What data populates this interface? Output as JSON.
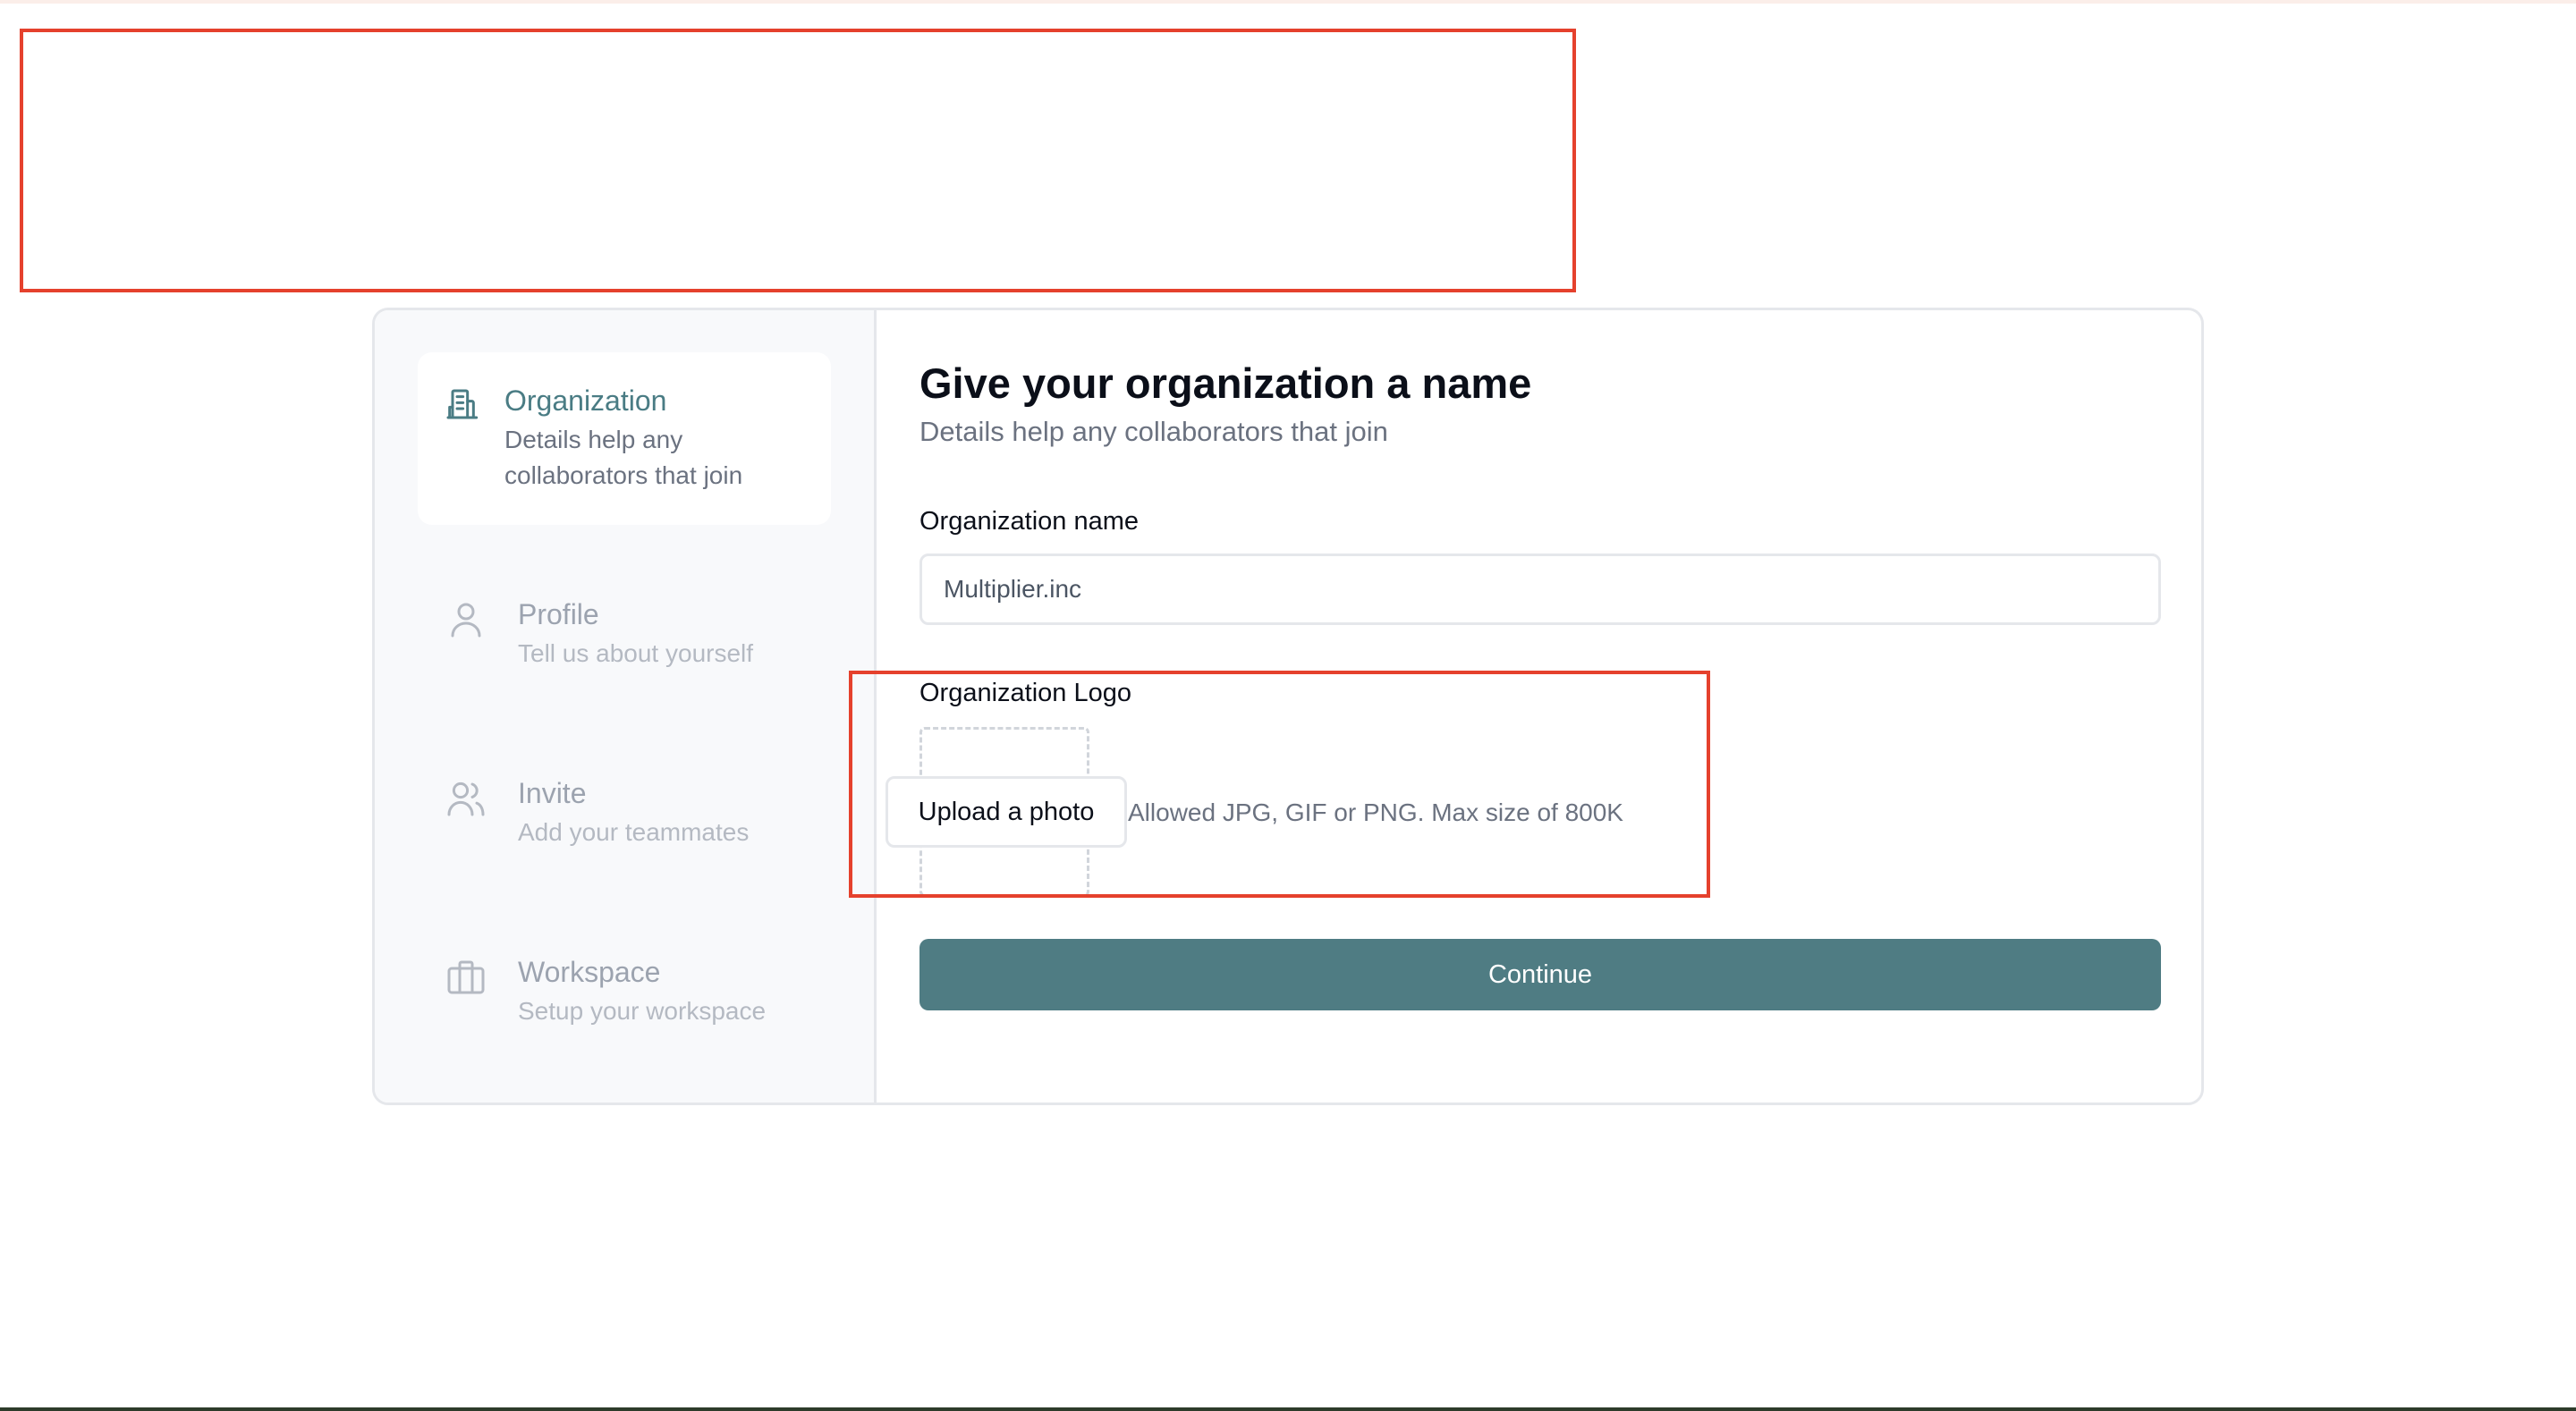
{
  "steps": [
    {
      "title": "Organization",
      "subtitle_line1": "Details help any",
      "subtitle_line2": "collaborators that join",
      "icon": "building-icon",
      "state": "active"
    },
    {
      "title": "Profile",
      "subtitle": "Tell us about yourself",
      "icon": "user-icon",
      "state": "inactive"
    },
    {
      "title": "Invite",
      "subtitle": "Add your teammates",
      "icon": "users-icon",
      "state": "inactive"
    },
    {
      "title": "Workspace",
      "subtitle": "Setup your workspace",
      "icon": "briefcase-icon",
      "state": "inactive"
    }
  ],
  "form": {
    "heading": "Give your organization a name",
    "subheading": "Details help any collaborators that join",
    "org_name_label": "Organization name",
    "org_name_value": "Multiplier.inc",
    "org_logo_label": "Organization Logo",
    "upload_label": "Upload a photo",
    "upload_hint": "Allowed JPG, GIF or PNG. Max size of 800K",
    "continue_label": "Continue"
  },
  "colors": {
    "accent": "#4f7c83",
    "active_text": "#4a7c84",
    "highlight_border": "#e5412d"
  }
}
